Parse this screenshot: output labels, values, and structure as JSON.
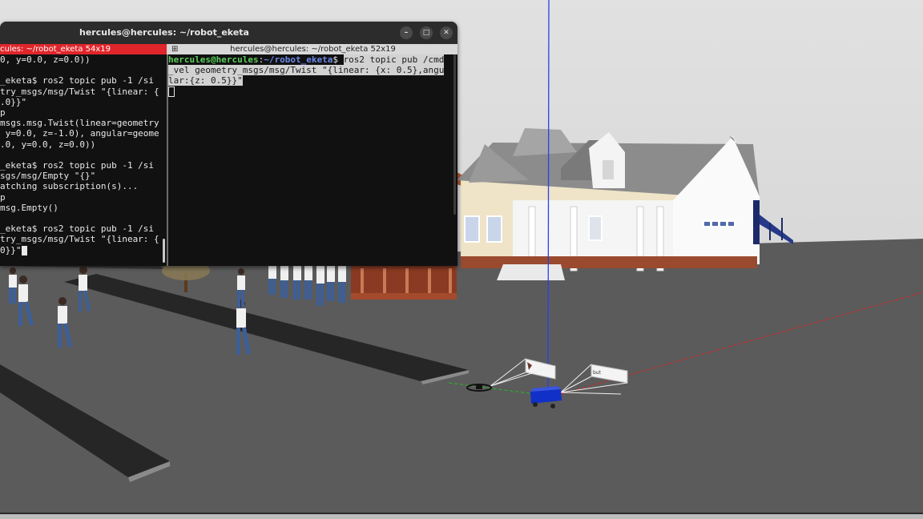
{
  "window": {
    "title": "hercules@hercules: ~/robot_eketa",
    "minimize_icon": "minimize-icon",
    "maximize_icon": "maximize-icon",
    "close_icon": "close-icon"
  },
  "tabs": {
    "left": "cules: ~/robot_eketa 54x19",
    "right": "hercules@hercules: ~/robot_eketa 52x19",
    "right_icon": "split-terminal-icon"
  },
  "left_pane": {
    "lines": [
      "0, y=0.0, z=0.0))",
      "",
      "_eketa$ ros2 topic pub -1 /si",
      "try_msgs/msg/Twist \"{linear: {",
      ".0}}\"",
      "p",
      "msgs.msg.Twist(linear=geometry",
      " y=0.0, z=-1.0), angular=geome",
      ".0, y=0.0, z=0.0))",
      "",
      "_eketa$ ros2 topic pub -1 /si",
      "sgs/msg/Empty \"{}\"",
      "atching subscription(s)...",
      "p",
      "msg.Empty()",
      "",
      "_eketa$ ros2 topic pub -1 /si",
      "try_msgs/msg/Twist \"{linear: {",
      "0}}\""
    ]
  },
  "right_pane": {
    "prompt_user": "hercules@hercules",
    "prompt_sep": ":",
    "prompt_path": "~/robot_eketa",
    "prompt_dollar": "$ ",
    "command_lines": [
      "ros2 topic pub /cmd",
      "_vel geometry_msgs/msg/Twist \"{linear: {x: 0.5},angu",
      "lar:{z: 0.5}}\""
    ]
  },
  "colors": {
    "sky": "#d9d9d9",
    "ground": "#5a5a5a",
    "robot": "#1030c8",
    "active_tab": "#e0262b",
    "prompt_green": "#5bd05b",
    "prompt_blue": "#6c8ae8"
  }
}
